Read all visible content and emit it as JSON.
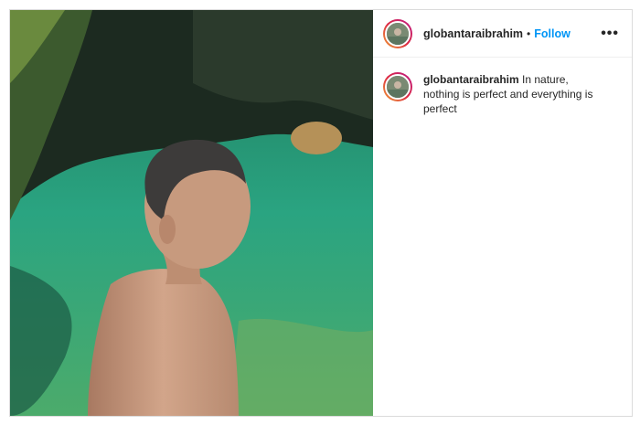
{
  "post": {
    "username": "globantaraibrahim",
    "separator": "•",
    "follow_label": "Follow",
    "more_label": "•••",
    "caption_username": "globantaraibrahim",
    "caption_text": "In nature, nothing is perfect and everything is perfect"
  },
  "icons": [
    "avatar",
    "more-options-icon"
  ],
  "colors": {
    "follow": "#0095f6",
    "border": "#dbdbdb",
    "text": "#262626"
  }
}
